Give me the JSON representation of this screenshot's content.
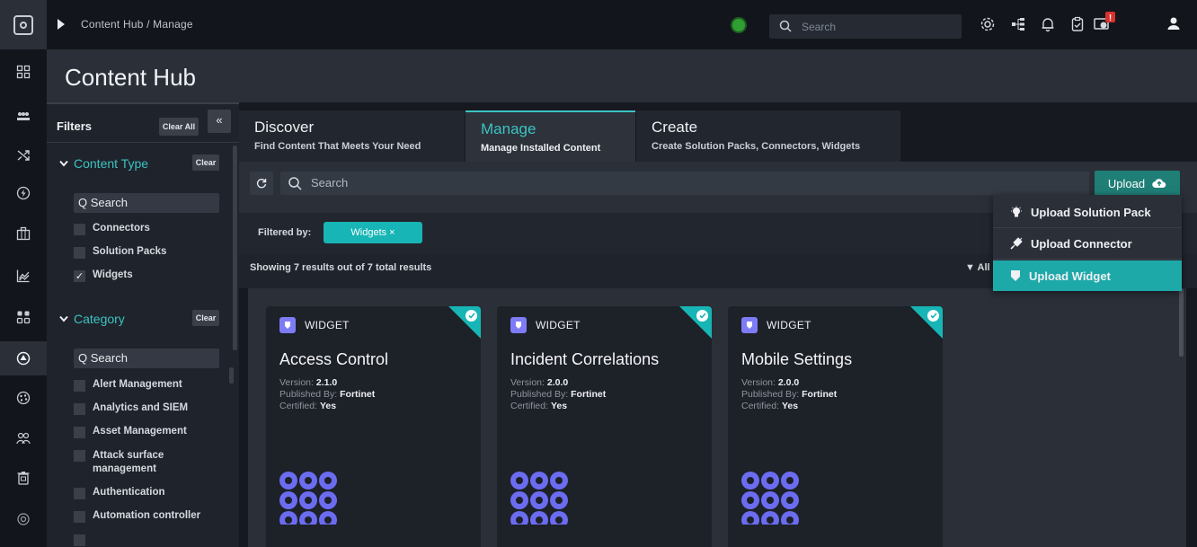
{
  "topbar": {
    "breadcrumb": "Content Hub / Manage",
    "search_placeholder": "Search",
    "notification_badge": "!"
  },
  "header": {
    "title": "Content Hub"
  },
  "filters": {
    "title": "Filters",
    "clear_all": "Clear All",
    "collapse": "«",
    "content_type": {
      "label": "Content Type",
      "clear": "Clear",
      "search_placeholder": "Search",
      "items": [
        {
          "label": "Connectors",
          "checked": false
        },
        {
          "label": "Solution Packs",
          "checked": false
        },
        {
          "label": "Widgets",
          "checked": true
        }
      ]
    },
    "category": {
      "label": "Category",
      "clear": "Clear",
      "search_placeholder": "Search",
      "items": [
        {
          "label": "Alert Management"
        },
        {
          "label": "Analytics and SIEM"
        },
        {
          "label": "Asset Management"
        },
        {
          "label": "Attack surface management"
        },
        {
          "label": "Authentication"
        },
        {
          "label": "Automation controller"
        }
      ]
    }
  },
  "tabs": [
    {
      "title": "Discover",
      "subtitle": "Find Content That Meets Your Need",
      "active": false
    },
    {
      "title": "Manage",
      "subtitle": "Manage Installed Content",
      "active": true
    },
    {
      "title": "Create",
      "subtitle": "Create Solution Packs, Connectors, Widgets",
      "active": false
    }
  ],
  "search": {
    "placeholder": "Search"
  },
  "upload": {
    "label": "Upload",
    "menu": [
      {
        "label": "Upload Solution Pack",
        "highlighted": false
      },
      {
        "label": "Upload Connector",
        "highlighted": false
      },
      {
        "label": "Upload Widget",
        "highlighted": true
      }
    ]
  },
  "filter_bar": {
    "label": "Filtered by:",
    "pill": "Widgets  ×"
  },
  "results": {
    "text": "Showing 7 results out of 7 total results",
    "filter_label": "All"
  },
  "cards": [
    {
      "type": "WIDGET",
      "title": "Access Control",
      "version_label": "Version:",
      "version": "2.1.0",
      "publisher_label": "Published By:",
      "publisher": "Fortinet",
      "certified_label": "Certified:",
      "certified": "Yes"
    },
    {
      "type": "WIDGET",
      "title": "Incident Correlations",
      "version_label": "Version:",
      "version": "2.0.0",
      "publisher_label": "Published By:",
      "publisher": "Fortinet",
      "certified_label": "Certified:",
      "certified": "Yes"
    },
    {
      "type": "WIDGET",
      "title": "Mobile Settings",
      "version_label": "Version:",
      "version": "2.0.0",
      "publisher_label": "Published By:",
      "publisher": "Fortinet",
      "certified_label": "Certified:",
      "certified": "Yes"
    }
  ],
  "colors": {
    "accent": "#3cc3c3",
    "upload_button": "#1f7f77",
    "pill": "#17b5b5",
    "widget_badge": "#7d7cf6",
    "status_green": "#2f9e33"
  }
}
